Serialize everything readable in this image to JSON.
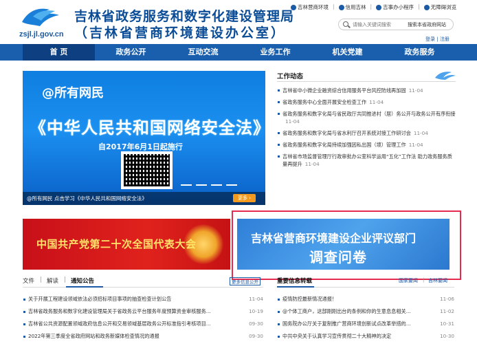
{
  "header": {
    "domain_text": "zsjl.jl.gov.cn",
    "title_line1": "吉林省政务服务和数字化建设管理局",
    "title_line2": "（吉林省营商环境建设办公室）",
    "toplinks": [
      "吉林营商环境",
      "信用吉林",
      "吉事办小程序",
      "无障碍浏览"
    ],
    "search_placeholder": "请输入关键词搜索",
    "search_scope": "搜索本省政府网站",
    "login": "登录",
    "register": "注册"
  },
  "nav": {
    "items": [
      "首 页",
      "政务公开",
      "互动交流",
      "业务工作",
      "机关党建",
      "政务服务"
    ]
  },
  "banner": {
    "headline": "@所有网民",
    "law_title": "《中华人民共和国网络安全法》",
    "effective": "自2017年6月1日起施行",
    "caption": "@所有网民 点击学习《中华人民共和国网络安全法》",
    "more_label": "更多"
  },
  "work_news": {
    "title": "工作动态",
    "items": [
      {
        "text": "吉林省中小微企业融资综合信用服务平台风控防线再加固",
        "date": "11-04"
      },
      {
        "text": "省政务服务中心全面开展安全检查工作",
        "date": "11-04"
      },
      {
        "text": "省政务服务和数字化局与省民政厅共同推进村（居）务公开与政务公开有序衔接",
        "date": "11-04"
      },
      {
        "text": "省政务服务和数字化局与省水利厅召开系统对接工作研讨会",
        "date": "11-04"
      },
      {
        "text": "省政务服务和数字化局持续加强因私出国（境）管理工作",
        "date": "11-04"
      },
      {
        "text": "吉林省市场监督管理厅行政审批办公室科学运用“五化”工作法 助力政务服务质量再提升",
        "date": "11-04"
      }
    ]
  },
  "promo": {
    "red_banner": "中国共产党第二十次全国代表大会",
    "survey_line1": "吉林省营商环境建设企业评议部门",
    "survey_line2": "调查问卷"
  },
  "left_tabs": {
    "tabs": [
      "文件",
      "解读",
      "通知公告"
    ],
    "separator": "|",
    "more": "更多信息公开"
  },
  "right_tabs": {
    "title": "重要信息转载",
    "subs": [
      "国家要闻",
      "吉林要闻"
    ],
    "separator": "|"
  },
  "notices": [
    {
      "text": "关于开展工程建设领域依法必须招标项目事项的抽查检查计划公告",
      "date": "11-04"
    },
    {
      "text": "吉林省政务服务和数字化建设管理局关于省政务云平台服务年度预算资金审核服务...",
      "date": "10-19"
    },
    {
      "text": "吉林省公共资源配置领域政府信息公开和交易领域基层政务公开标准指引考核项目...",
      "date": "09-30"
    },
    {
      "text": "2022年第三季度全省政府网站和政务新媒体检查情况的通报",
      "date": "09-30"
    }
  ],
  "reposts": [
    {
      "text": "疫情防控最新情况通报！",
      "date": "11-06"
    },
    {
      "text": "@个体工商户，这部刚刚出台的条例和你的生意息息相关...",
      "date": "11-02"
    },
    {
      "text": "国务院办公厅关于复制推广营商环境创新试点改革举措的...",
      "date": "10-31"
    },
    {
      "text": "中共中央关于认真学习宣传贯彻二十大精神的决定",
      "date": "10-30"
    }
  ],
  "colors": {
    "brand_blue": "#1a5fad",
    "nav_active": "#0e3f80",
    "highlight_red": "#e52b4f",
    "party_red": "#e0221c"
  }
}
